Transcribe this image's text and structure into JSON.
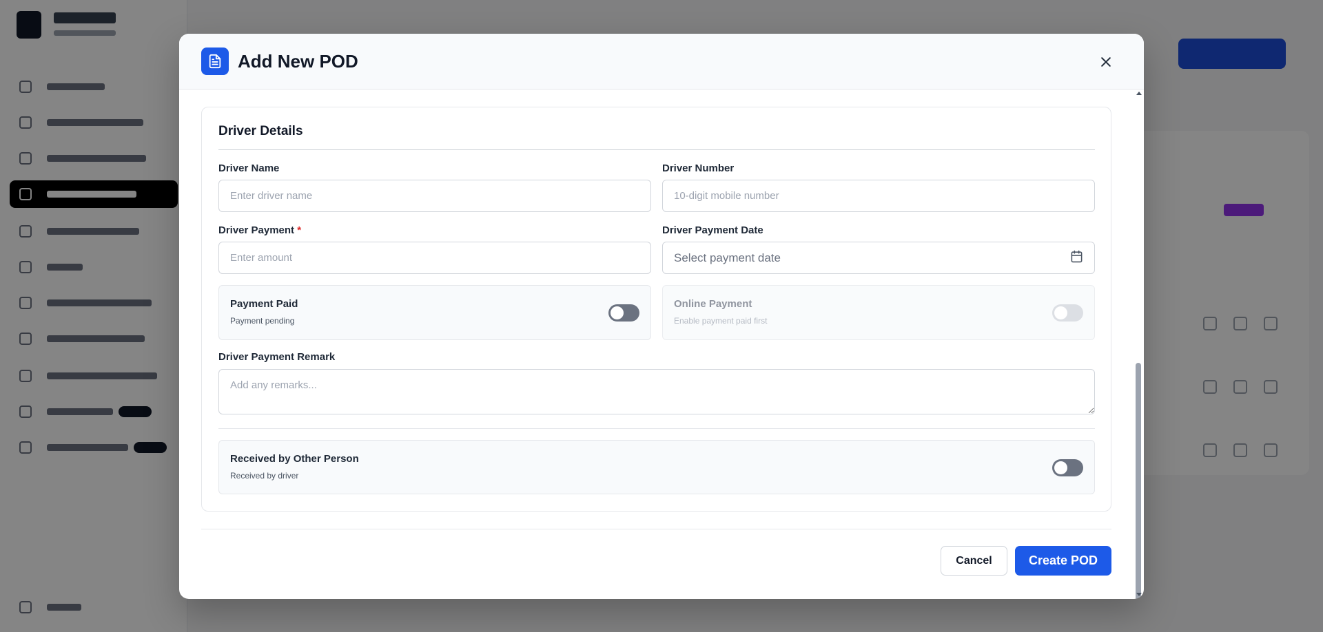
{
  "modal": {
    "title": "Add New POD",
    "icon": "document-icon",
    "close_icon": "close-icon"
  },
  "driver_details": {
    "title": "Driver Details",
    "driver_name": {
      "label": "Driver Name",
      "placeholder": "Enter driver name",
      "value": ""
    },
    "driver_number": {
      "label": "Driver Number",
      "placeholder": "10-digit mobile number",
      "value": ""
    },
    "driver_payment": {
      "label": "Driver Payment",
      "required_mark": "*",
      "placeholder": "Enter amount",
      "value": ""
    },
    "driver_payment_date": {
      "label": "Driver Payment Date",
      "placeholder": "Select payment date",
      "icon": "calendar-icon"
    },
    "payment_paid": {
      "title": "Payment Paid",
      "subtitle": "Payment pending",
      "enabled": false
    },
    "online_payment": {
      "title": "Online Payment",
      "subtitle": "Enable payment paid first",
      "enabled": false,
      "disabled": true
    },
    "remark": {
      "label": "Driver Payment Remark",
      "placeholder": "Add any remarks...",
      "value": ""
    },
    "received_by_other": {
      "title": "Received by Other Person",
      "subtitle": "Received by driver",
      "enabled": false
    }
  },
  "footer": {
    "cancel_label": "Cancel",
    "create_label": "Create POD"
  },
  "colors": {
    "primary": "#1d5ae8",
    "required": "#dc2626",
    "toggle_off": "#6b7280"
  }
}
